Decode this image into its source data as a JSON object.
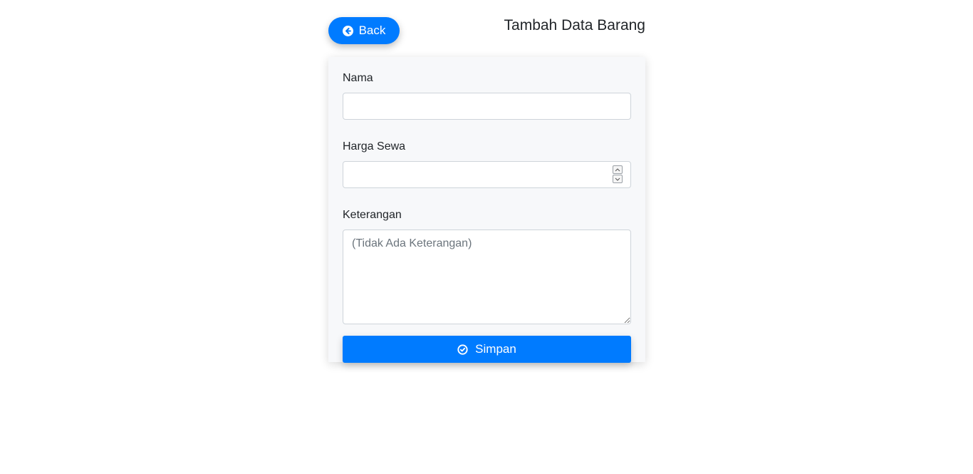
{
  "header": {
    "back_label": "Back",
    "back_icon": "arrow-circle-left-icon",
    "title": "Tambah Data Barang"
  },
  "form": {
    "nama": {
      "label": "Nama",
      "value": "",
      "placeholder": ""
    },
    "harga_sewa": {
      "label": "Harga Sewa",
      "value": "",
      "placeholder": ""
    },
    "keterangan": {
      "label": "Keterangan",
      "value": "",
      "placeholder": "(Tidak Ada Keterangan)"
    },
    "submit_label": "Simpan",
    "submit_icon": "check-circle-icon"
  },
  "colors": {
    "primary": "#007bff",
    "card_background": "#f7f8fa",
    "border": "#ced4da"
  }
}
